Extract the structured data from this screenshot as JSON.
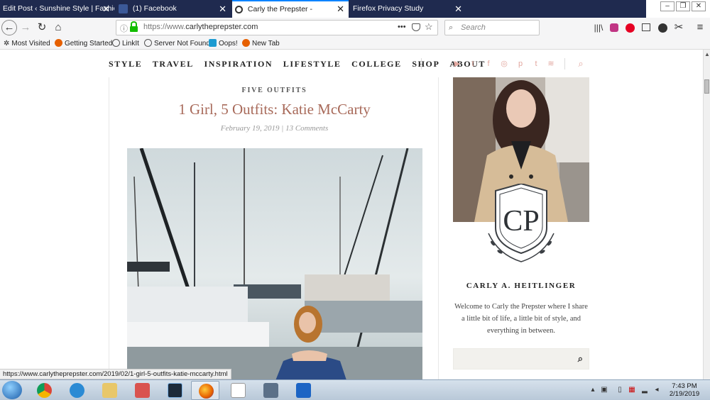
{
  "browser": {
    "tabs": [
      {
        "label": "Edit Post ‹ Sunshine Style | Fashion",
        "close": "✕"
      },
      {
        "label": "(1) Facebook",
        "close": "✕"
      },
      {
        "label": "Carly the Prepster -",
        "close": "✕"
      },
      {
        "label": "Firefox Privacy Study",
        "close": "✕"
      }
    ],
    "window_controls": {
      "minimize": "–",
      "maximize": "❐",
      "close": "✕"
    },
    "url": {
      "protocol": "https://www.",
      "domain": "carlytheprepster.com"
    },
    "search_placeholder": "Search",
    "page_actions": "•••",
    "bookmarks": [
      {
        "label": "Most Visited",
        "color": "#555555"
      },
      {
        "label": "Getting Started",
        "color": "#e66000"
      },
      {
        "label": "LinkIt",
        "color": "#666666"
      },
      {
        "label": "Server Not Found",
        "color": "#666666"
      },
      {
        "label": "Oops!",
        "color": "#1d9bd1"
      },
      {
        "label": "New Tab",
        "color": "#e66000"
      }
    ],
    "status_link": "https://www.carlytheprepster.com/2019/02/1-girl-5-outfits-katie-mccarty.html"
  },
  "site": {
    "nav": [
      "STYLE",
      "TRAVEL",
      "INSPIRATION",
      "LIFESTYLE",
      "COLLEGE",
      "SHOP",
      "ABOUT"
    ],
    "social_icons": [
      "youtube-icon",
      "twitter-icon",
      "facebook-icon",
      "instagram-icon",
      "pinterest-icon",
      "tumblr-icon",
      "rss-icon"
    ],
    "social_glyphs": [
      "▶",
      "t",
      "f",
      "◎",
      "p",
      "t",
      "≋"
    ],
    "search_glyph": "⌕",
    "accent_color": "#a86a5a",
    "social_color": "#e2a8a0"
  },
  "post": {
    "category": "FIVE OUTFITS",
    "title": "1 Girl, 5 Outfits: Katie McCarty",
    "date": "February 19, 2019",
    "comments": "13 Comments",
    "meta_separator": " | "
  },
  "sidebar": {
    "author": "CARLY A. HEITLINGER",
    "bio": "Welcome to Carly the Prepster where I share a little bit of life, a little bit of style, and everything in between.",
    "crest_letters": "CP"
  },
  "taskbar": {
    "time": "7:43 PM",
    "date": "2/19/2019"
  }
}
